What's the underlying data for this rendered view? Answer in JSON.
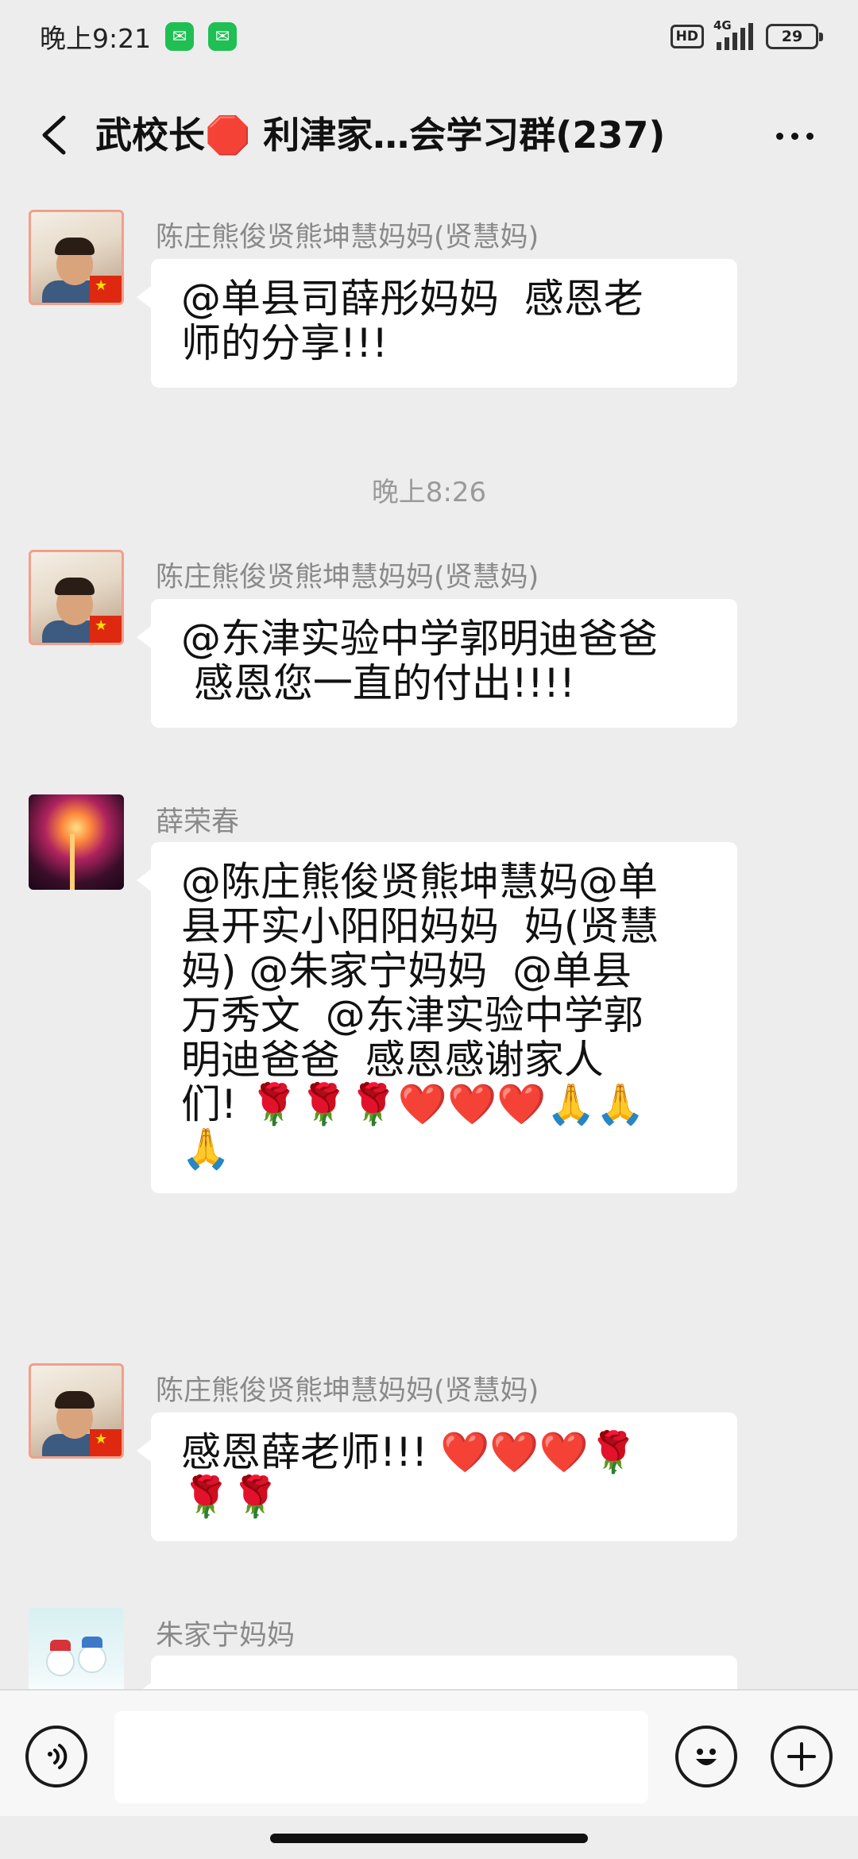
{
  "status_bar": {
    "time": "晚上9:21",
    "notification_icons": [
      "wechat-icon",
      "wechat-icon"
    ],
    "hd_label": "HD",
    "network_label": "4G",
    "battery_level": "29"
  },
  "header": {
    "back_icon": "chevron-left-icon",
    "title": "武校长🛑 利津家…会学习群(237)",
    "more_icon": "more-dots-icon"
  },
  "messages": [
    {
      "sender": "陈庄熊俊贤熊坤慧妈妈(贤慧妈)",
      "avatar": "child-photo-avatar",
      "lines": [
        "@单县司薛彤妈妈  感恩老",
        "师的分享!!!"
      ]
    },
    {
      "sender": "陈庄熊俊贤熊坤慧妈妈(贤慧妈)",
      "avatar": "child-photo-avatar",
      "lines": [
        "@东津实验中学郭明迪爸爸",
        " 感恩您一直的付出!!!!"
      ]
    },
    {
      "sender": "薛荣春",
      "avatar": "fireworks-avatar",
      "lines": [
        "@陈庄熊俊贤熊坤慧妈@单",
        "县开实小阳阳妈妈  妈(贤慧",
        "妈) @朱家宁妈妈  @单县",
        "万秀文  @东津实验中学郭",
        "明迪爸爸  感恩感谢家人",
        "们! 🌹🌹🌹❤️❤️❤️🙏🙏",
        "🙏"
      ]
    },
    {
      "sender": "陈庄熊俊贤熊坤慧妈妈(贤慧妈)",
      "avatar": "child-photo-avatar",
      "lines": [
        "感恩薛老师!!! ❤️❤️❤️🌹",
        "🌹🌹"
      ]
    },
    {
      "sender": "朱家宁妈妈",
      "avatar": "snowman-avatar",
      "lines": []
    }
  ],
  "time_divider": "晚上8:26",
  "input_bar": {
    "voice_icon": "voice-icon",
    "emoji_icon": "smiley-icon",
    "plus_icon": "plus-icon",
    "input_value": ""
  },
  "colors": {
    "background": "#ededed",
    "bubble": "#ffffff",
    "sender_text": "#8a8a8a",
    "wechat_green": "#1fbf53"
  }
}
